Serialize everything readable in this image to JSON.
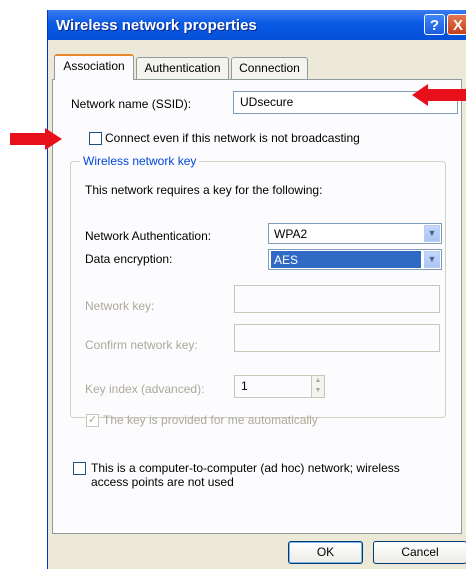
{
  "window": {
    "title": "Wireless network properties",
    "help_symbol": "?",
    "close_symbol": "X"
  },
  "tabs": [
    {
      "label": "Association",
      "active": true
    },
    {
      "label": "Authentication",
      "active": false
    },
    {
      "label": "Connection",
      "active": false
    }
  ],
  "association": {
    "ssid_label": "Network name (SSID):",
    "ssid_value": "UDsecure",
    "broadcast_checkbox_label": "Connect even if this network is not broadcasting",
    "broadcast_checked": false,
    "key_group_title": "Wireless network key",
    "key_requirement_text": "This network requires a key for the following:",
    "auth_label": "Network Authentication:",
    "auth_value": "WPA2",
    "encryption_label": "Data encryption:",
    "encryption_value": "AES",
    "network_key_label": "Network key:",
    "confirm_key_label": "Confirm network key:",
    "key_index_label": "Key index (advanced):",
    "key_index_value": "1",
    "auto_key_label": "The key is provided for me automatically",
    "auto_key_checked": true,
    "adhoc_label_line1": "This is a computer-to-computer (ad hoc) network; wireless",
    "adhoc_label_line2": "access points are not used",
    "adhoc_checked": false
  },
  "buttons": {
    "ok": "OK",
    "cancel": "Cancel"
  },
  "colors": {
    "annotation_arrow": "#e8101a",
    "titlebar": "#0a5ae6",
    "selection": "#316ac5"
  }
}
